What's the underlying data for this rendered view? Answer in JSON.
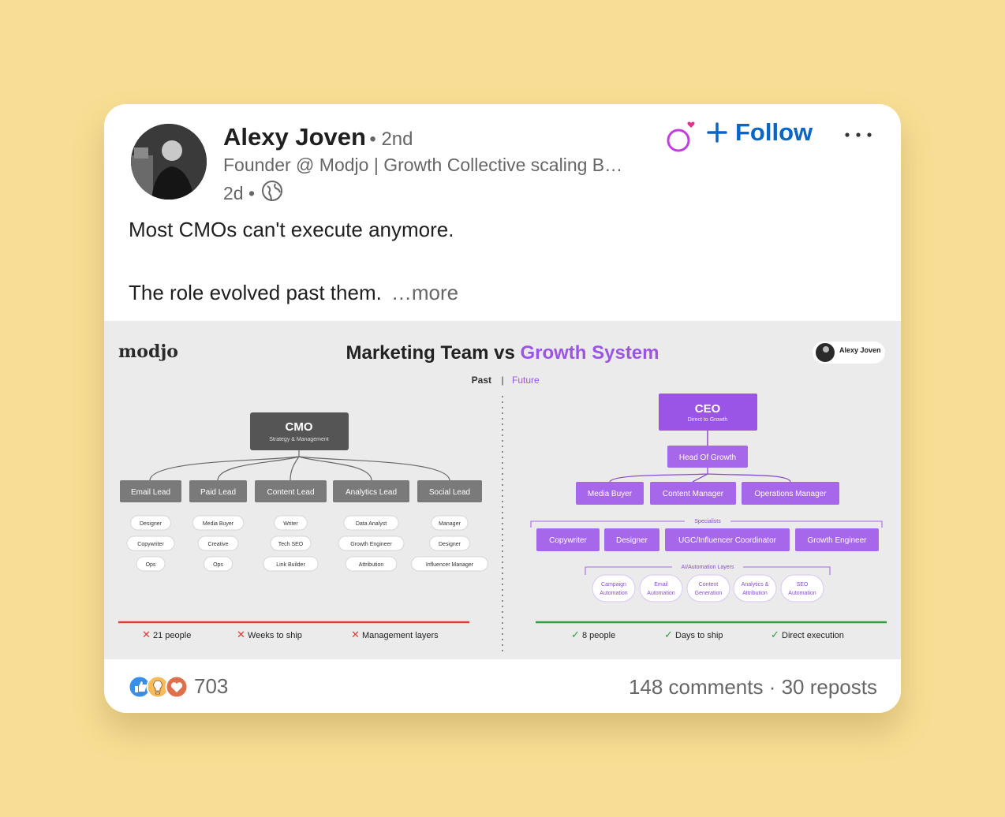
{
  "post": {
    "author": "Alexy Joven",
    "degree": "• 2nd",
    "headline": "Founder @ Modjo | Growth Collective scaling B…",
    "time": "2d •",
    "follow_label": "Follow",
    "text_line1": "Most CMOs can't execute anymore.",
    "text_line2": "The role evolved past them.",
    "see_more": "…more"
  },
  "infographic": {
    "logo": "modjo",
    "title_part1": "Marketing Team vs ",
    "title_part2": "Growth System",
    "tag_name": "Alexy Joven",
    "past": "Past",
    "future": "Future",
    "cmo": "CMO",
    "cmo_sub": "Strategy & Management",
    "leads": [
      "Email Lead",
      "Paid Lead",
      "Content Lead",
      "Analytics Lead",
      "Social Lead"
    ],
    "sub_roles": [
      [
        "Designer",
        "Copywriter",
        "Ops"
      ],
      [
        "Media Buyer",
        "Creative",
        "Ops"
      ],
      [
        "Writer",
        "Tech SEO",
        "Link Builder"
      ],
      [
        "Data Analyst",
        "Growth Engineer",
        "Attribution"
      ],
      [
        "Manager",
        "Designer",
        "Influencer Manager"
      ]
    ],
    "left_stats": [
      "21 people",
      "Weeks to ship",
      "Management layers"
    ],
    "ceo": "CEO",
    "ceo_sub": "Direct to Growth",
    "head": "Head Of Growth",
    "managers": [
      "Media Buyer",
      "Content Manager",
      "Operations Manager"
    ],
    "specialists_label": "Specialists",
    "specialists": [
      "Copywriter",
      "Designer",
      "UGC/Influencer Coordinator",
      "Growth Engineer"
    ],
    "ai_label": "AI/Automation Layers",
    "ai": [
      [
        "Campaign",
        "Automation"
      ],
      [
        "Email",
        "Automation"
      ],
      [
        "Content",
        "Generation"
      ],
      [
        "Analytics &",
        "Attribution"
      ],
      [
        "SEO",
        "Automation"
      ]
    ],
    "right_stats": [
      "8 people",
      "Days to ship",
      "Direct execution"
    ]
  },
  "engagement": {
    "reactions": "703",
    "comments_reposts": "148 comments · 30 reposts"
  },
  "colors": {
    "link": "#0a66c2",
    "purple": "#9b55e6",
    "dark_box": "#555555",
    "red": "#e53935",
    "green": "#2e9e3e"
  }
}
